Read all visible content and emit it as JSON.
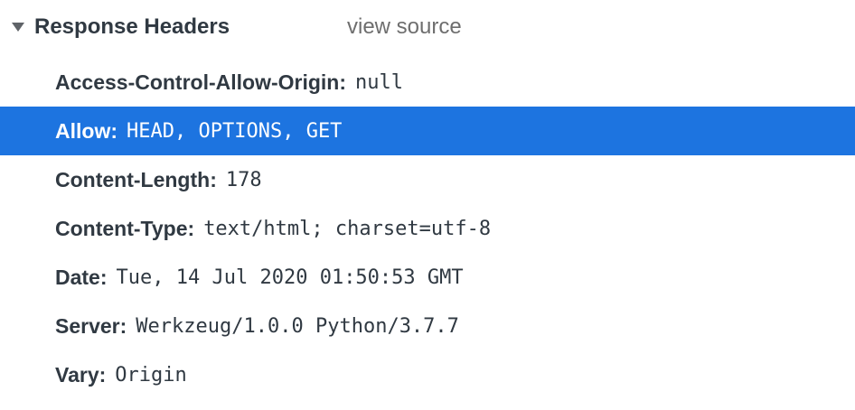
{
  "section": {
    "title": "Response Headers",
    "view_source_label": "view source",
    "disclosure_icon": "triangle-down-icon",
    "expanded": true
  },
  "colors": {
    "selection": "#1d74e0",
    "text": "#303942",
    "muted": "#6e6e6e"
  },
  "headers": [
    {
      "name": "Access-Control-Allow-Origin",
      "value": "null",
      "selected": false
    },
    {
      "name": "Allow",
      "value": "HEAD, OPTIONS, GET",
      "selected": true
    },
    {
      "name": "Content-Length",
      "value": "178",
      "selected": false
    },
    {
      "name": "Content-Type",
      "value": "text/html; charset=utf-8",
      "selected": false
    },
    {
      "name": "Date",
      "value": "Tue, 14 Jul 2020 01:50:53 GMT",
      "selected": false
    },
    {
      "name": "Server",
      "value": "Werkzeug/1.0.0 Python/3.7.7",
      "selected": false
    },
    {
      "name": "Vary",
      "value": "Origin",
      "selected": false
    }
  ]
}
